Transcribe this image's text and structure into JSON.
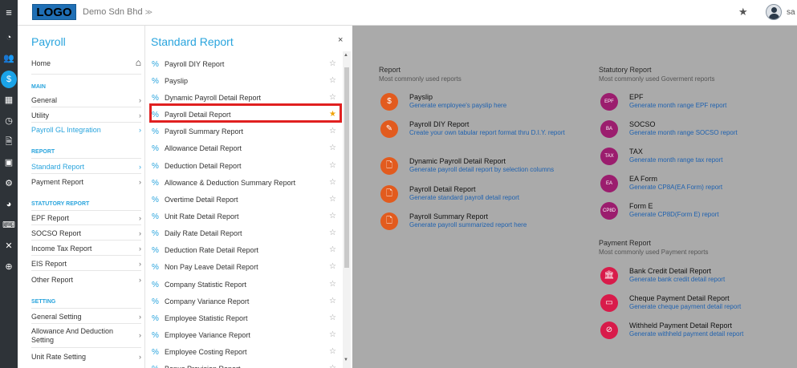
{
  "topbar": {
    "menu_icon": "hamburger-icon",
    "logo": "LOGO",
    "company": "Demo Sdn Bhd",
    "company_chevron": "≫",
    "star_icon": "star-icon",
    "user": "sa"
  },
  "rail": [
    "dashboard-icon",
    "users-icon",
    "payroll-icon",
    "calendar-icon",
    "clock-icon",
    "document-icon",
    "calendar-check-icon",
    "settings-icon",
    "pie-chart-icon",
    "keyboard-icon",
    "tools-icon",
    "plus-circle-icon"
  ],
  "nav": {
    "title": "Payroll",
    "home": "Home",
    "sections": {
      "main": "MAIN",
      "report": "REPORT",
      "statutory": "STATUTORY REPORT",
      "setting": "SETTING"
    },
    "main_items": [
      {
        "label": "General",
        "chev": "›"
      },
      {
        "label": "Utility",
        "chev": "›"
      },
      {
        "label": "Payroll GL Integration",
        "chev": "›"
      }
    ],
    "report_items": [
      {
        "label": "Standard Report",
        "chev": "›"
      },
      {
        "label": "Payment Report",
        "chev": "›"
      }
    ],
    "statutory_items": [
      {
        "label": "EPF Report",
        "chev": "›"
      },
      {
        "label": "SOCSO Report",
        "chev": "›"
      },
      {
        "label": "Income Tax Report",
        "chev": "›"
      },
      {
        "label": "EIS Report",
        "chev": "›"
      },
      {
        "label": "Other Report",
        "chev": "›"
      }
    ],
    "setting_items": [
      {
        "label": "General Setting",
        "chev": "›"
      },
      {
        "label": "Allowance And Deduction Setting",
        "chev": "›"
      },
      {
        "label": "Unit Rate Setting",
        "chev": "›"
      }
    ]
  },
  "standard_report": {
    "title": "Standard Report",
    "close": "×",
    "items": [
      {
        "label": "Payroll DIY Report",
        "starred": false
      },
      {
        "label": "Payslip",
        "starred": false
      },
      {
        "label": "Dynamic Payroll Detail Report",
        "starred": false
      },
      {
        "label": "Payroll Detail Report",
        "starred": true
      },
      {
        "label": "Payroll Summary Report",
        "starred": false
      },
      {
        "label": "Allowance Detail Report",
        "starred": false
      },
      {
        "label": "Deduction Detail Report",
        "starred": false
      },
      {
        "label": "Allowance & Deduction Summary Report",
        "starred": false
      },
      {
        "label": "Overtime Detail Report",
        "starred": false
      },
      {
        "label": "Unit Rate Detail Report",
        "starred": false
      },
      {
        "label": "Daily Rate Detail Report",
        "starred": false
      },
      {
        "label": "Deduction Rate Detail Report",
        "starred": false
      },
      {
        "label": "Non Pay Leave Detail Report",
        "starred": false
      },
      {
        "label": "Company Statistic Report",
        "starred": false
      },
      {
        "label": "Company Variance Report",
        "starred": false
      },
      {
        "label": "Employee Statistic Report",
        "starred": false
      },
      {
        "label": "Employee Variance Report",
        "starred": false
      },
      {
        "label": "Employee Costing Report",
        "starred": false
      },
      {
        "label": "Bonus Provision Report",
        "starred": false
      }
    ]
  },
  "report_group": {
    "title": "Report",
    "subtitle": "Most commonly used reports",
    "items": [
      {
        "icon": "$",
        "title": "Payslip",
        "desc": "Generate employee's payslip here"
      },
      {
        "icon": "✎",
        "title": "Payroll DIY Report",
        "desc": "Create your own tabular report format thru D.I.Y. report"
      },
      {
        "icon": "🗋",
        "title": "Dynamic Payroll Detail Report",
        "desc": "Generate payroll detail report by selection columns"
      },
      {
        "icon": "🗋",
        "title": "Payroll Detail Report",
        "desc": "Generate standard payroll detail report"
      },
      {
        "icon": "🗋",
        "title": "Payroll Summary Report",
        "desc": "Generate payroll summarized report here"
      }
    ]
  },
  "statutory_group": {
    "title": "Statutory Report",
    "subtitle": "Most commonly used Goverment reports",
    "items": [
      {
        "icon": "EPF",
        "title": "EPF",
        "desc": "Generate month range EPF report"
      },
      {
        "icon": "BA",
        "title": "SOCSO",
        "desc": "Generate month range SOCSO report"
      },
      {
        "icon": "TAX",
        "title": "TAX",
        "desc": "Generate month range tax report"
      },
      {
        "icon": "EA",
        "title": "EA Form",
        "desc": "Generate CP8A(EA Form) report"
      },
      {
        "icon": "CP8D",
        "title": "Form E",
        "desc": "Generate CP8D(Form E) report"
      }
    ]
  },
  "payment_group": {
    "title": "Payment Report",
    "subtitle": "Most commonly used Payment reports",
    "items": [
      {
        "icon": "🏛",
        "title": "Bank Credit Detail Report",
        "desc": "Generate bank credit detail report"
      },
      {
        "icon": "▭",
        "title": "Cheque Payment Detail Report",
        "desc": "Generate cheque payment detail report"
      },
      {
        "icon": "⊘",
        "title": "Withheld Payment Detail Report",
        "desc": "Generate withheld payment detail report"
      }
    ]
  }
}
